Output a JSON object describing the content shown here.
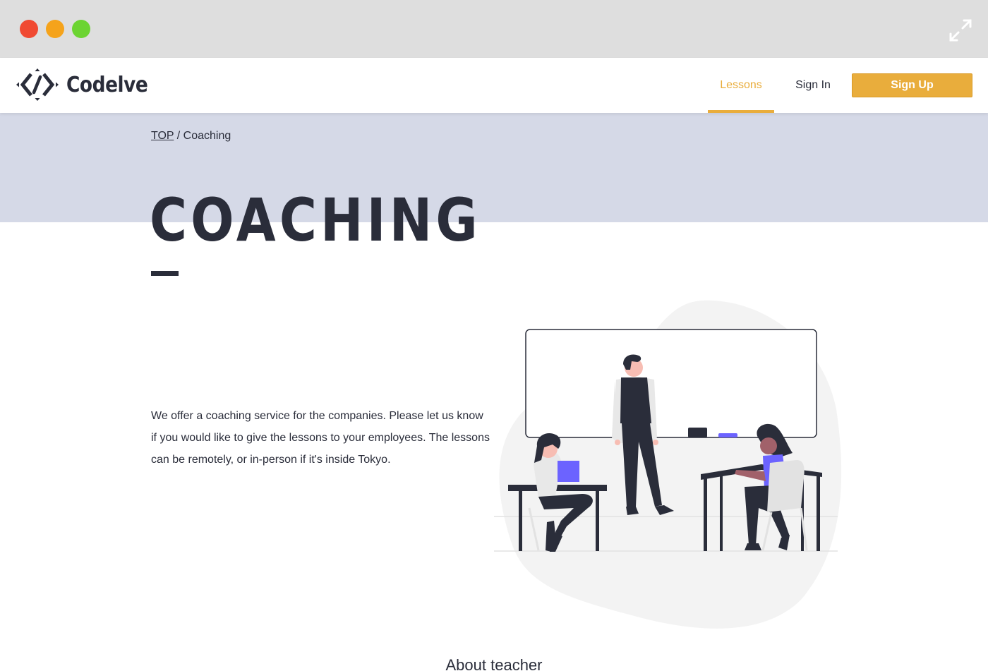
{
  "window": {
    "controls": [
      "close",
      "minimize",
      "zoom"
    ],
    "expand_icon": "expand-icon"
  },
  "header": {
    "logo_text": "Codelve",
    "nav": {
      "lessons": "Lessons",
      "sign_in": "Sign In",
      "sign_up": "Sign Up"
    }
  },
  "breadcrumb": {
    "home": "TOP",
    "separator": " / ",
    "current": "Coaching"
  },
  "page": {
    "title": "COACHING",
    "intro": "We offer a coaching service for the companies. Please let us know if you would like to give the lessons to your employees. The lessons can be remotely, or in-person if it's inside Tokyo.",
    "section_heading": "About teacher"
  },
  "colors": {
    "accent": "#e9ad3c",
    "dark": "#2a2d3a",
    "hero_band": "#d5d9e7",
    "illustration_purple": "#6c63ff"
  }
}
